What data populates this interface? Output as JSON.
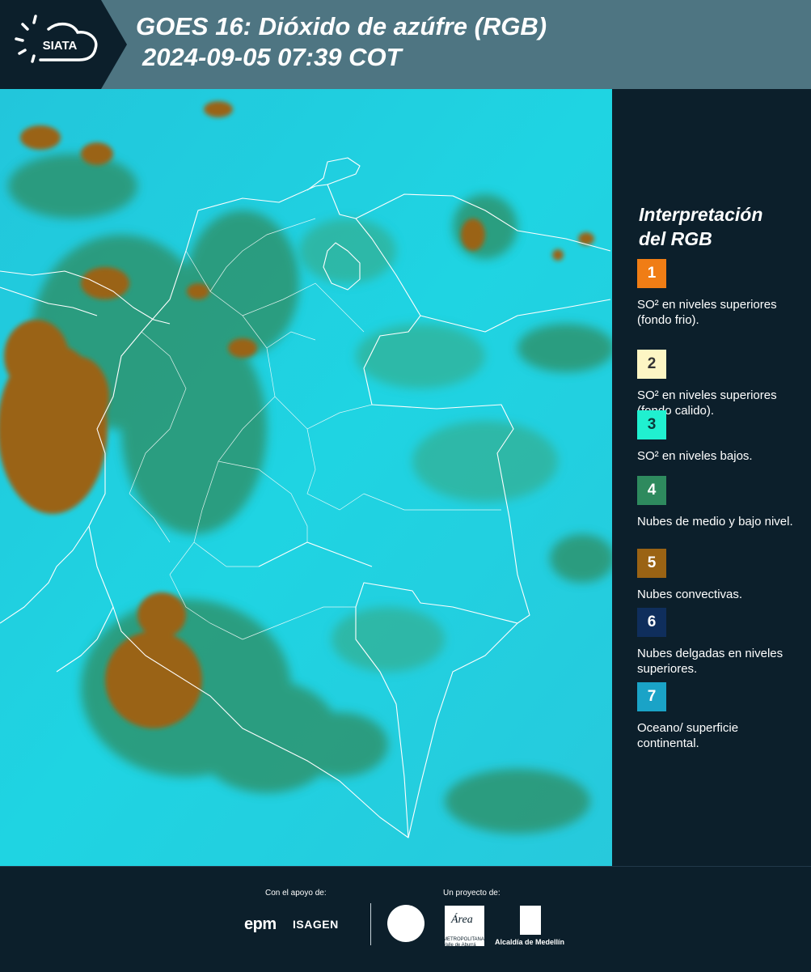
{
  "header": {
    "logo_text": "SIATA",
    "title_line1": "GOES 16: Dióxido de azúfre (RGB)",
    "title_line2": "2024-09-05 07:39 COT"
  },
  "legend": {
    "title_line1": "Interpretación",
    "title_line2": "del RGB",
    "items": [
      {
        "number": "1",
        "text": "SO² en niveles superiores (fondo frio).",
        "color": "#f07d15"
      },
      {
        "number": "2",
        "text": "SO² en niveles superiores (fondo calido).",
        "color": "#fdf6c4"
      },
      {
        "number": "3",
        "text": "SO² en niveles bajos.",
        "color": "#20f0d0"
      },
      {
        "number": "4",
        "text": "Nubes de medio y bajo nivel.",
        "color": "#2e8a5e"
      },
      {
        "number": "5",
        "text": "Nubes convectivas.",
        "color": "#9a6314"
      },
      {
        "number": "6",
        "text": "Nubes delgadas en niveles superiores.",
        "color": "#0f2e5c"
      },
      {
        "number": "7",
        "text": "Oceano/ superficie continental.",
        "color": "#1aa3c7"
      }
    ]
  },
  "footer": {
    "support_label": "Con el apoyo de:",
    "project_label": "Un proyecto de:",
    "epm_text": "epm",
    "isagen_text": "ISAGEN",
    "area_text": "Área",
    "area_caption": "METROPOLITANA Valle de Aburrá",
    "alcaldia_text": "Alcaldía de Medellín"
  },
  "map": {
    "colors": {
      "ocean_surface": "#1ecfe0",
      "convective": "#9a6418",
      "mid_low_clouds": "#2e8a5e",
      "borders": "#ffffff"
    }
  }
}
